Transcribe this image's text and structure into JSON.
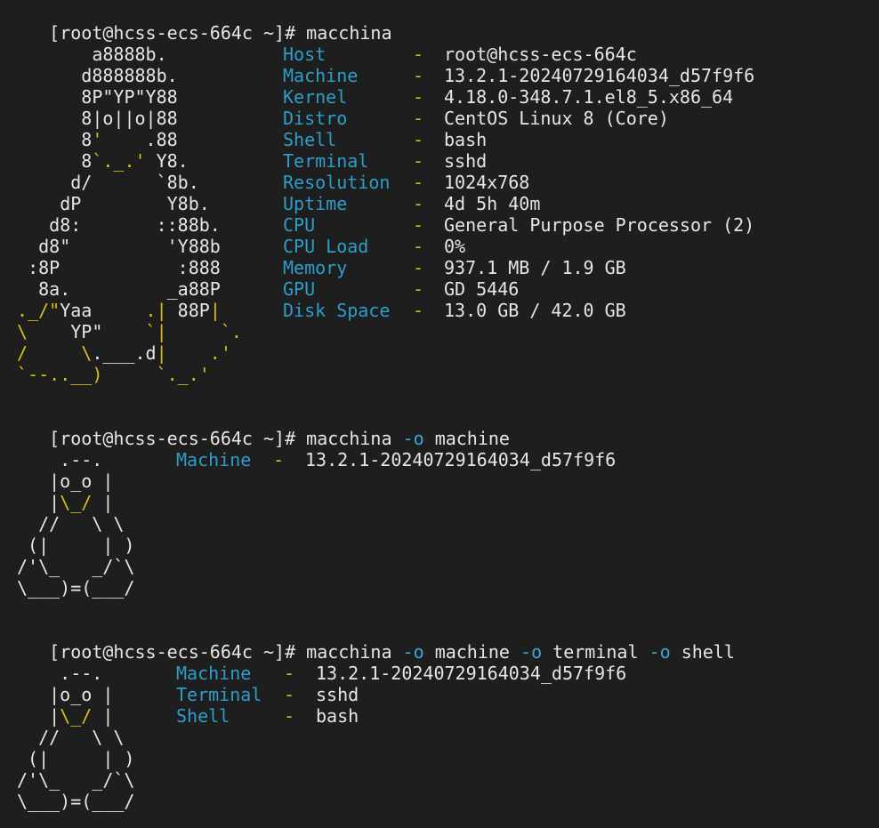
{
  "terminal": {
    "prompt": "[root@hcss-ecs-664c ~]#",
    "commands": [
      {
        "parts": [
          {
            "text": "macchina",
            "flag": false
          }
        ]
      },
      {
        "parts": [
          {
            "text": "macchina",
            "flag": false
          },
          {
            "text": "-o",
            "flag": true
          },
          {
            "text": "machine",
            "flag": false
          }
        ]
      },
      {
        "parts": [
          {
            "text": "macchina",
            "flag": false
          },
          {
            "text": "-o",
            "flag": true
          },
          {
            "text": "machine",
            "flag": false
          },
          {
            "text": "-o",
            "flag": true
          },
          {
            "text": "terminal",
            "flag": false
          },
          {
            "text": "-o",
            "flag": true
          },
          {
            "text": "shell",
            "flag": false
          }
        ]
      }
    ]
  },
  "separator": "-",
  "full_output": {
    "ascii_logo": [
      [
        {
          "t": "        a8888b.",
          "c": "w"
        }
      ],
      [
        {
          "t": "       d888888b.",
          "c": "w"
        }
      ],
      [
        {
          "t": "       8P\"YP\"Y88",
          "c": "w"
        }
      ],
      [
        {
          "t": "       8|o||o|88",
          "c": "w"
        }
      ],
      [
        {
          "t": "       8",
          "c": "w"
        },
        {
          "t": "'",
          "c": "y"
        },
        {
          "t": "    .88",
          "c": "w"
        }
      ],
      [
        {
          "t": "       8",
          "c": "w"
        },
        {
          "t": "`._.'",
          "c": "y"
        },
        {
          "t": " Y8.",
          "c": "w"
        }
      ],
      [
        {
          "t": "      d/      `8b.",
          "c": "w"
        }
      ],
      [
        {
          "t": "     dP        Y8b.",
          "c": "w"
        }
      ],
      [
        {
          "t": "    d8:       ::88b.",
          "c": "w"
        }
      ],
      [
        {
          "t": "   d8\"         'Y88b",
          "c": "w"
        }
      ],
      [
        {
          "t": "  :8P           :888",
          "c": "w"
        }
      ],
      [
        {
          "t": "   8a.         _a88P",
          "c": "w"
        }
      ],
      [
        {
          "t": " ._/\"",
          "c": "y"
        },
        {
          "t": "Yaa",
          "c": "w"
        },
        {
          "t": "     .|",
          "c": "y"
        },
        {
          "t": " 88P",
          "c": "w"
        },
        {
          "t": "|",
          "c": "y"
        }
      ],
      [
        {
          "t": " \\    ",
          "c": "y"
        },
        {
          "t": "YP\"",
          "c": "w"
        },
        {
          "t": "    `|     `.",
          "c": "y"
        }
      ],
      [
        {
          "t": " /     \\",
          "c": "y"
        },
        {
          "t": ".___.d",
          "c": "w"
        },
        {
          "t": "|    .'",
          "c": "y"
        }
      ],
      [
        {
          "t": " `--..__)     `._.'",
          "c": "y"
        }
      ]
    ],
    "rows": [
      {
        "key": "Host",
        "value": "root@hcss-ecs-664c"
      },
      {
        "key": "Machine",
        "value": "13.2.1-20240729164034_d57f9f6"
      },
      {
        "key": "Kernel",
        "value": "4.18.0-348.7.1.el8_5.x86_64"
      },
      {
        "key": "Distro",
        "value": "CentOS Linux 8 (Core)"
      },
      {
        "key": "Shell",
        "value": "bash"
      },
      {
        "key": "Terminal",
        "value": "sshd"
      },
      {
        "key": "Resolution",
        "value": "1024x768"
      },
      {
        "key": "Uptime",
        "value": "4d 5h 40m"
      },
      {
        "key": "CPU",
        "value": "General Purpose Processor (2)"
      },
      {
        "key": "CPU Load",
        "value": "0%"
      },
      {
        "key": "Memory",
        "value": "937.1 MB / 1.9 GB"
      },
      {
        "key": "GPU",
        "value": "GD 5446"
      },
      {
        "key": "Disk Space",
        "value": "13.0 GB / 42.0 GB"
      }
    ]
  },
  "small_logo": [
    [
      {
        "t": "    .--.",
        "c": "w"
      }
    ],
    [
      {
        "t": "   |o_o |",
        "c": "w"
      }
    ],
    [
      {
        "t": "   |",
        "c": "w"
      },
      {
        "t": "\\_/",
        "c": "y"
      },
      {
        "t": " |",
        "c": "w"
      }
    ],
    [
      {
        "t": "  //   \\ \\",
        "c": "w"
      }
    ],
    [
      {
        "t": " (|     | )",
        "c": "w"
      }
    ],
    [
      {
        "t": "/'\\_   _/`\\",
        "c": "w"
      }
    ],
    [
      {
        "t": "\\___)=(___/",
        "c": "w"
      }
    ]
  ],
  "output_machine": {
    "rows": [
      {
        "key": "Machine",
        "value": "13.2.1-20240729164034_d57f9f6"
      }
    ]
  },
  "output_three": {
    "rows": [
      {
        "key": "Machine",
        "value": "13.2.1-20240729164034_d57f9f6"
      },
      {
        "key": "Terminal",
        "value": "sshd"
      },
      {
        "key": "Shell",
        "value": "bash"
      }
    ]
  }
}
